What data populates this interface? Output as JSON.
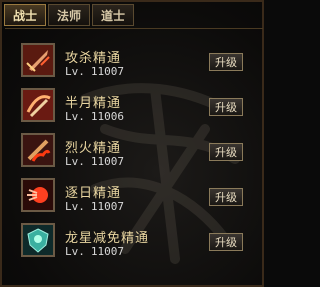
{
  "tabs": [
    {
      "label": "战士"
    },
    {
      "label": "法师"
    },
    {
      "label": "道士"
    }
  ],
  "lv_label": "Lv.",
  "skills": [
    {
      "name": "攻杀精通",
      "level": "11007",
      "button": "升级",
      "icon": "sword-slash-icon"
    },
    {
      "name": "半月精通",
      "level": "11006",
      "button": "升级",
      "icon": "crescent-slash-icon"
    },
    {
      "name": "烈火精通",
      "level": "11007",
      "button": "升级",
      "icon": "fire-sword-icon"
    },
    {
      "name": "逐日精通",
      "level": "11007",
      "button": "升级",
      "icon": "sun-chase-icon"
    },
    {
      "name": "龙星减免精通",
      "level": "11007",
      "button": "升级",
      "icon": "dragon-shield-icon"
    }
  ],
  "colors": {
    "skill_name": "#e8d5a0",
    "level_text": "#d8d8d8",
    "border": "#6b5a45"
  }
}
